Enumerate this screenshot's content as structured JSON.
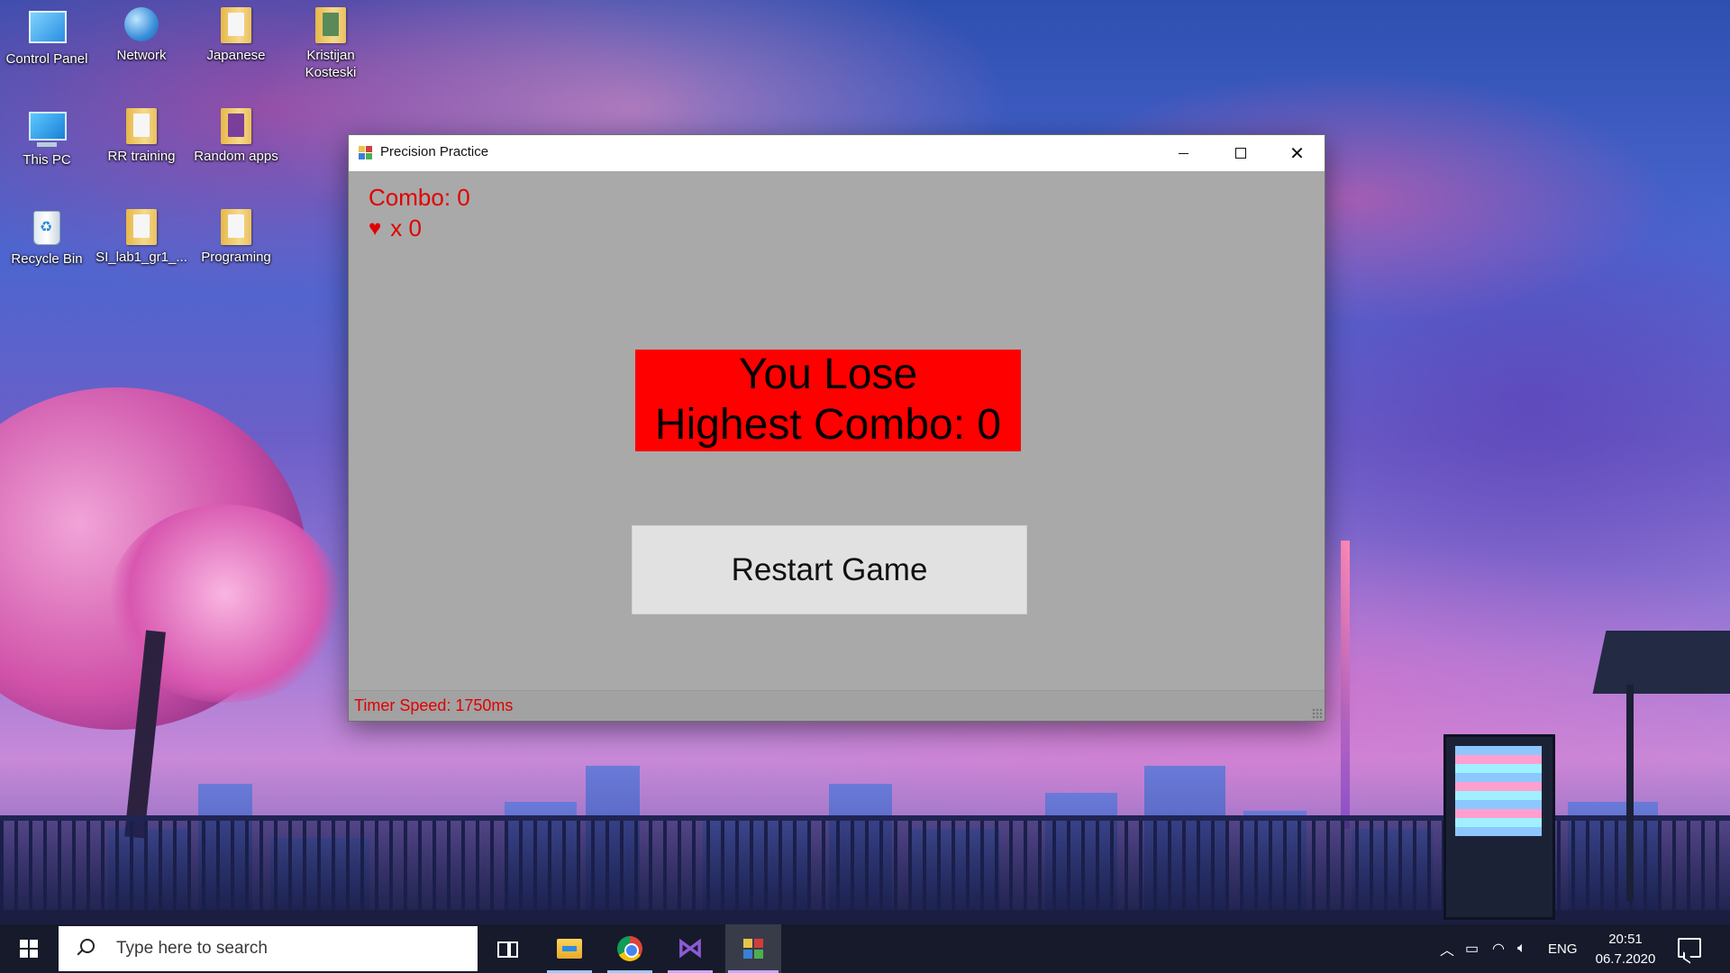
{
  "desktop": {
    "icons": [
      {
        "label": "Control Panel",
        "icon": "control-panel-icon"
      },
      {
        "label": "Network",
        "icon": "network-icon"
      },
      {
        "label": "Japanese",
        "icon": "folder-icon"
      },
      {
        "label": "Kristijan Kosteski",
        "icon": "user-folder-icon"
      },
      {
        "label": "This PC",
        "icon": "computer-icon"
      },
      {
        "label": "RR training",
        "icon": "folder-icon"
      },
      {
        "label": "Random apps",
        "icon": "folder-icon"
      },
      {
        "label": "Recycle Bin",
        "icon": "recycle-bin-icon"
      },
      {
        "label": "SI_lab1_gr1_...",
        "icon": "folder-icon"
      },
      {
        "label": "Programing",
        "icon": "folder-icon"
      }
    ]
  },
  "window": {
    "title": "Precision Practice",
    "combo": "Combo: 0",
    "lives": "x 0",
    "lose_line1": "You Lose",
    "lose_line2": "Highest Combo: 0",
    "restart_label": "Restart Game",
    "timer_speed": "Timer Speed: 1750ms"
  },
  "taskbar": {
    "search_placeholder": "Type here to search",
    "language": "ENG",
    "time": "20:51",
    "date": "06.7.2020",
    "apps": [
      "task-view",
      "file-explorer",
      "google-chrome",
      "visual-studio",
      "precision-practice"
    ]
  },
  "colors": {
    "accent_red": "#ff0000",
    "text_red": "#e00000",
    "window_bg": "#a9a9a9",
    "taskbar_bg": "#161a2a"
  }
}
